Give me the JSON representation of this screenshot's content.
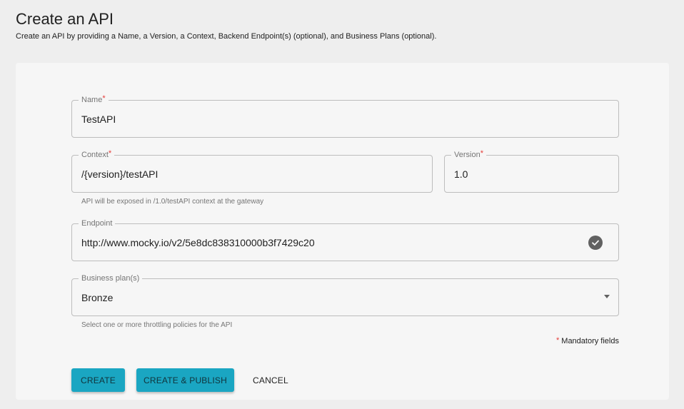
{
  "header": {
    "title": "Create an API",
    "subtitle": "Create an API by providing a Name, a Version, a Context, Backend Endpoint(s) (optional), and Business Plans (optional)."
  },
  "form": {
    "name": {
      "label": "Name",
      "required_mark": "*",
      "value": "TestAPI"
    },
    "context": {
      "label": "Context",
      "required_mark": "*",
      "value": "/{version}/testAPI",
      "helper": "API will be exposed in /1.0/testAPI context at the gateway"
    },
    "version": {
      "label": "Version",
      "required_mark": "*",
      "value": "1.0"
    },
    "endpoint": {
      "label": "Endpoint",
      "value": "http://www.mocky.io/v2/5e8dc838310000b3f7429c20",
      "status_icon": "check-circle-icon"
    },
    "business_plans": {
      "label": "Business plan(s)",
      "value": "Bronze",
      "helper": "Select one or more throttling policies for the API",
      "icon": "caret-down-icon"
    },
    "mandatory_note": {
      "mark": "*",
      "text": "Mandatory fields"
    }
  },
  "actions": {
    "create_label": "CREATE",
    "create_publish_label": "CREATE & PUBLISH",
    "cancel_label": "CANCEL"
  },
  "colors": {
    "primary_button": "#1aa6c2",
    "required": "#e53935",
    "card_background": "#f6f6f6",
    "page_background": "#eeeeee"
  }
}
